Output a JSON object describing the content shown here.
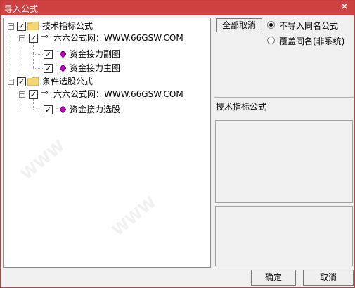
{
  "window": {
    "title": "导入公式",
    "close_glyph": "✕"
  },
  "tree": {
    "groups": [
      {
        "label": "技术指标公式",
        "checked": true,
        "source": {
          "label": "六六公式网：WWW.66GSW.COM",
          "checked": true
        },
        "items": [
          {
            "label": "资金接力副图",
            "checked": true
          },
          {
            "label": "资金接力主图",
            "checked": true
          }
        ]
      },
      {
        "label": "条件选股公式",
        "checked": true,
        "source": {
          "label": "六六公式网：WWW.66GSW.COM",
          "checked": true
        },
        "items": [
          {
            "label": "资金接力选股",
            "checked": true
          }
        ]
      }
    ]
  },
  "options": {
    "cancel_all_label": "全部取消",
    "radio_skip_label": "不导入同名公式",
    "radio_overwrite_label": "覆盖同名(非系统)",
    "selected": "skip"
  },
  "info": {
    "formula_type_label": "技术指标公式"
  },
  "buttons": {
    "ok": "确定",
    "cancel": "取消"
  },
  "icons": {
    "folder": "folder-icon",
    "key": "key-icon",
    "formula": "formula-diamond-icon",
    "check": "checkmark-icon"
  },
  "colors": {
    "title_bar": "#cf4040",
    "folder": "#f5d76e",
    "diamond": "#c000c0"
  }
}
